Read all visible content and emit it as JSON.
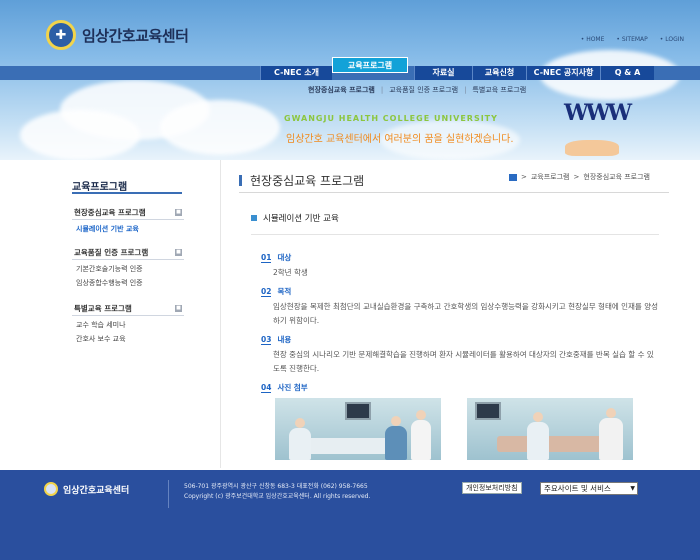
{
  "header": {
    "logo_text": "임상간호교육센터",
    "util_links": [
      "HOME",
      "SITEMAP",
      "LOGIN"
    ],
    "nav": [
      {
        "label": "C-NEC 소개",
        "active": false
      },
      {
        "label": "교육프로그램",
        "active": true
      },
      {
        "label": "자료실",
        "active": false
      },
      {
        "label": "교육신청",
        "active": false
      },
      {
        "label": "C-NEC 공지사항",
        "active": false
      },
      {
        "label": "Q & A",
        "active": false
      }
    ],
    "subnav": [
      "현장중심교육 프로그램",
      "교육품질 인증 프로그램",
      "특별교육 프로그램"
    ],
    "slogan_en": "GWANGJU HEALTH COLLEGE UNIVERSITY",
    "slogan_ko": "임상간호 교육센터에서 여러분의 꿈을 실현하겠습니다.",
    "graphic_text": "WWW"
  },
  "sidebar": {
    "title": "교육프로그램",
    "groups": [
      {
        "head": "현장중심교육 프로그램",
        "btn": "■",
        "items": [
          "시뮬레이션 기반 교육"
        ]
      },
      {
        "head": "교육품질 인증 프로그램",
        "btn": "■",
        "items": [
          "기본간호술기능력 인증",
          "임상종합수행능력 인증"
        ]
      },
      {
        "head": "특별교육 프로그램",
        "btn": "■",
        "items": [
          "교수 학습 세미나",
          "간호사 보수 교육"
        ]
      }
    ]
  },
  "main": {
    "page_title": "현장중심교육 프로그램",
    "breadcrumb": [
      "교육프로그램",
      "현장중심교육 프로그램"
    ],
    "section_title": "시뮬레이션 기반 교육",
    "items": [
      {
        "num": "01",
        "label": "대상",
        "body": "2학년 학생"
      },
      {
        "num": "02",
        "label": "목적",
        "body": "임상현장을 복제한 최첨단의 교내실습환경을 구축하고 간호학생의 임상수행능력을 강화시키고 현장실무 형태에 인재를 양성하기 위함이다."
      },
      {
        "num": "03",
        "label": "내용",
        "body": "현장 중심의 시나리오 기반 문제해결학습을 진행하며 환자 시뮬레이터를 활용하여 대상자의 간호중재를 반복 실습 할 수 있도록 진행한다."
      },
      {
        "num": "04",
        "label": "사진 첨부",
        "body": ""
      }
    ]
  },
  "footer": {
    "logo_text": "임상간호교육센터",
    "address": "506-701 광주광역시 광산구 신창동 683-3 대표전화 (062) 958-7665",
    "copyright": "Copyright (c) 광주보건대학교 임상간호교육센터. All rights reserved.",
    "privacy": "개인정보처리방침",
    "site_select": "주요사이트 및 서비스"
  },
  "colors": {
    "nav_bg": "#17499a",
    "nav_active": "#12a2d8",
    "accent": "#1d64c4",
    "footer_bg": "#2a4f9e",
    "slogan_en": "#8cc63f",
    "slogan_ko": "#f08a1c"
  }
}
